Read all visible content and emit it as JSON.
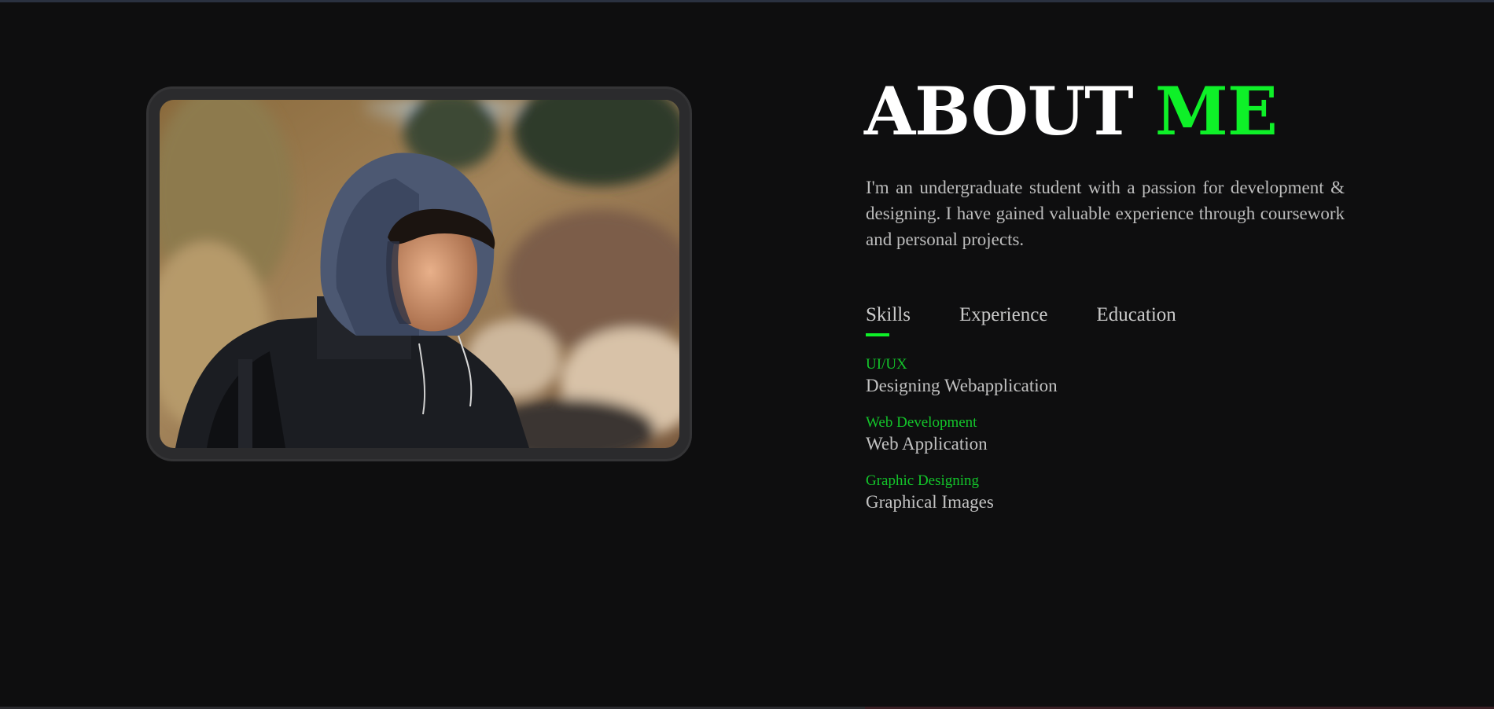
{
  "about": {
    "title_main": "ABOUT",
    "title_accent": "ME",
    "intro": "I'm an undergraduate student with a passion for development & designing. I have gained valuable experience through coursework and personal projects."
  },
  "tabs": [
    {
      "label": "Skills",
      "active": true
    },
    {
      "label": "Experience",
      "active": false
    },
    {
      "label": "Education",
      "active": false
    }
  ],
  "skills": [
    {
      "category": "UI/UX",
      "description": "Designing Webapplication"
    },
    {
      "category": "Web Development",
      "description": "Web Application"
    },
    {
      "category": "Graphic Designing",
      "description": "Graphical Images"
    }
  ],
  "colors": {
    "background": "#0e0e0f",
    "accent": "#0ef028",
    "accent_text": "#13c42a",
    "frame": "#2b2b2d"
  },
  "icons": [
    "profile-photo"
  ]
}
